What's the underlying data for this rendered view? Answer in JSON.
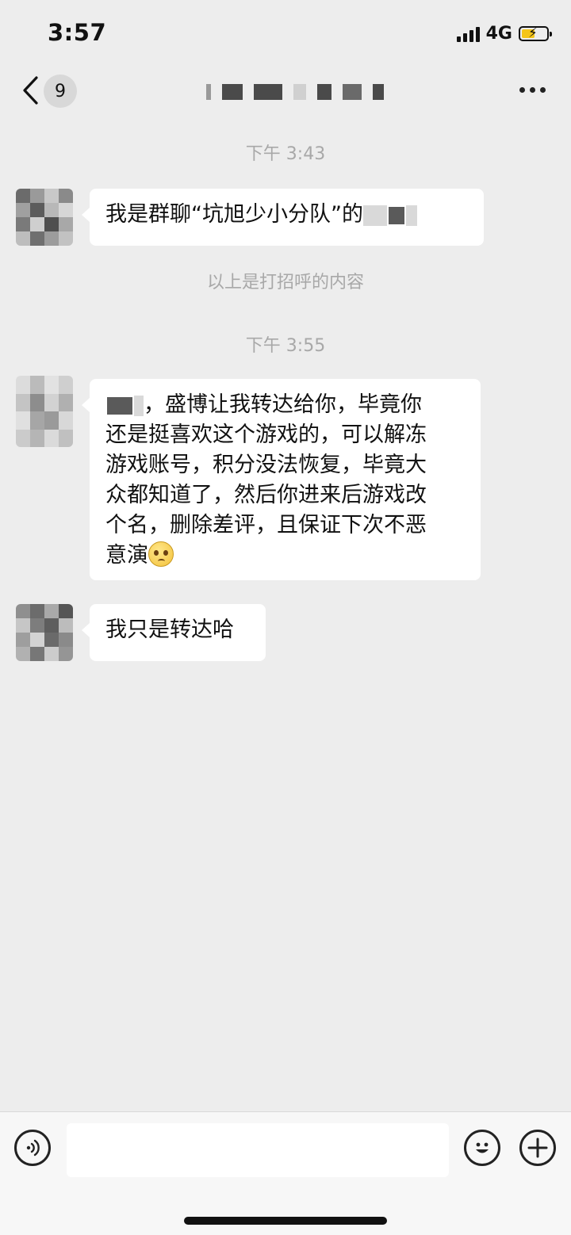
{
  "status_bar": {
    "time": "3:57",
    "network": "4G",
    "battery_charging": true
  },
  "nav": {
    "unread_count": "9",
    "title": "",
    "title_redacted": true
  },
  "messages": [
    {
      "type": "timestamp",
      "text": "下午 3:43"
    },
    {
      "type": "incoming",
      "prefix": "",
      "text": "我是群聊“坑旭少小分队”的",
      "redacted_tail": true
    },
    {
      "type": "system",
      "text": "以上是打招呼的内容"
    },
    {
      "type": "timestamp",
      "text": "下午 3:55"
    },
    {
      "type": "incoming",
      "redacted_head": true,
      "lines": [
        "，盛博让我转达给你，毕竟你",
        "还是挺喜欢这个游戏的，可以解冻",
        "游戏账号，积分没法恢复，毕竟大",
        "众都知道了，然后你进来后游戏改",
        "个名，删除差评，且保证下次不恶",
        "意演"
      ],
      "emoji": "pleading-face"
    },
    {
      "type": "incoming",
      "text": "我只是转达哈"
    }
  ],
  "input": {
    "value": "",
    "placeholder": ""
  },
  "icons": {
    "back": "back-chevron-icon",
    "more": "more-icon",
    "voice": "voice-icon",
    "emoji": "emoji-icon",
    "plus": "plus-icon"
  },
  "colors": {
    "background": "#ededed",
    "bubble": "#ffffff",
    "meta_text": "#a8a8a8"
  }
}
